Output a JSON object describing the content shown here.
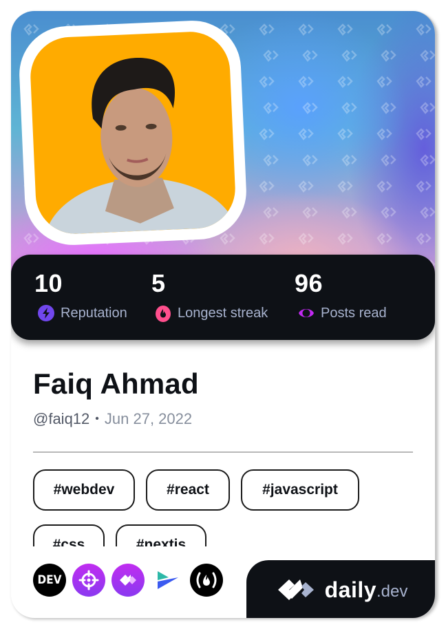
{
  "profile": {
    "name": "Faiq Ahmad",
    "handle": "@faiq12",
    "separator": "•",
    "joined": "Jun 27, 2022",
    "avatar": "avatar-photo"
  },
  "stats": [
    {
      "value": "10",
      "label": "Reputation",
      "icon": "lightning-icon",
      "color": "#7147ed"
    },
    {
      "value": "5",
      "label": "Longest streak",
      "icon": "flame-icon",
      "color": "#ff4f8d"
    },
    {
      "value": "96",
      "label": "Posts read",
      "icon": "eye-ring-icon",
      "color": "#c029f0"
    }
  ],
  "tags": [
    "#webdev",
    "#react",
    "#javascript",
    "#css",
    "#nextjs"
  ],
  "sources": [
    {
      "name": "DEV",
      "icon": "dev-to-icon"
    },
    {
      "name": "crosshair",
      "icon": "crosshair-icon"
    },
    {
      "name": "daily.dev",
      "icon": "daily-dev-icon"
    },
    {
      "name": "arrow",
      "icon": "play-arrow-icon"
    },
    {
      "name": "freeCodeCamp",
      "icon": "freecodecamp-icon",
      "glyph": "(🔥)"
    }
  ],
  "brand": {
    "daily": "daily",
    "dev": ".dev"
  },
  "colors": {
    "card_dark": "#0e1116",
    "stat_label": "#a8b3cf",
    "avatar_bg": "#ffab00",
    "accent_purple": "#c029f0"
  }
}
